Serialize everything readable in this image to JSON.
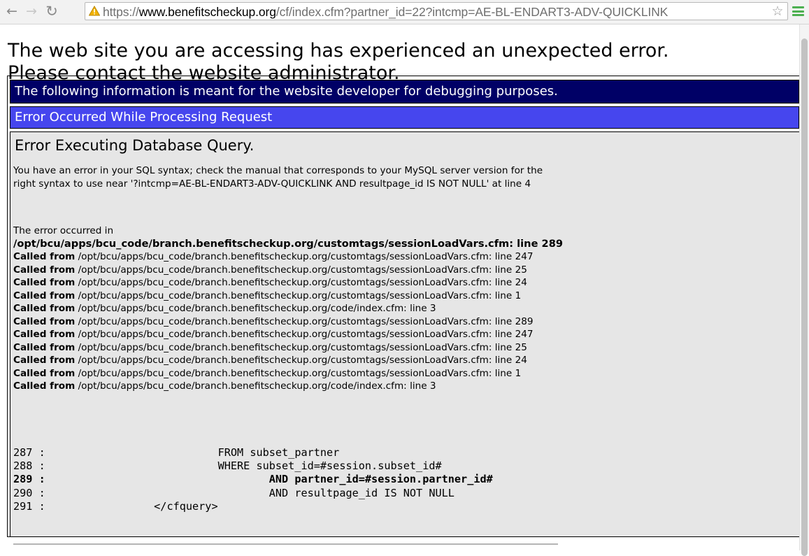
{
  "browser": {
    "back_glyph": "←",
    "forward_glyph": "→",
    "reload_glyph": "↻",
    "url_prefix": "https://",
    "url_host": "www.benefitscheckup.org",
    "url_rest": "/cf/index.cfm?partner_id=22?intcmp=AE-BL-ENDART3-ADV-QUICKLINK",
    "star_glyph": "☆",
    "accent_menu_color": "#4cb050",
    "warning_icon_color": "#f2b200"
  },
  "page": {
    "message_line1": "The web site you are accessing has experienced an unexpected error.",
    "message_line2": "Please contact the website administrator.",
    "debug_header": "The following information is meant for the website developer for debugging purposes.",
    "error_header": "Error Occurred While Processing Request",
    "error_title": "Error Executing Database Query.",
    "error_detail": "You have an error in your SQL syntax; check the manual that corresponds to your MySQL server version for the right syntax to use near '?intcmp=AE-BL-ENDART3-ADV-QUICKLINK AND resultpage_id IS NOT NULL' at line 4",
    "occurred_label": "The error occurred in",
    "occurred_location": "/opt/bcu/apps/bcu_code/branch.benefitscheckup.org/customtags/sessionLoadVars.cfm: line 289",
    "called_label": "Called from",
    "called_from": [
      " /opt/bcu/apps/bcu_code/branch.benefitscheckup.org/customtags/sessionLoadVars.cfm: line 247",
      " /opt/bcu/apps/bcu_code/branch.benefitscheckup.org/customtags/sessionLoadVars.cfm: line 25",
      " /opt/bcu/apps/bcu_code/branch.benefitscheckup.org/customtags/sessionLoadVars.cfm: line 24",
      " /opt/bcu/apps/bcu_code/branch.benefitscheckup.org/customtags/sessionLoadVars.cfm: line 1",
      " /opt/bcu/apps/bcu_code/branch.benefitscheckup.org/code/index.cfm: line 3",
      " /opt/bcu/apps/bcu_code/branch.benefitscheckup.org/customtags/sessionLoadVars.cfm: line 289",
      " /opt/bcu/apps/bcu_code/branch.benefitscheckup.org/customtags/sessionLoadVars.cfm: line 247",
      " /opt/bcu/apps/bcu_code/branch.benefitscheckup.org/customtags/sessionLoadVars.cfm: line 25",
      " /opt/bcu/apps/bcu_code/branch.benefitscheckup.org/customtags/sessionLoadVars.cfm: line 24",
      " /opt/bcu/apps/bcu_code/branch.benefitscheckup.org/customtags/sessionLoadVars.cfm: line 1",
      " /opt/bcu/apps/bcu_code/branch.benefitscheckup.org/code/index.cfm: line 3"
    ],
    "code_lines": [
      {
        "text": "287 :                           FROM subset_partner",
        "highlight": false
      },
      {
        "text": "288 :                           WHERE subset_id=#session.subset_id#",
        "highlight": false
      },
      {
        "text": "289 :                                   AND partner_id=#session.partner_id#",
        "highlight": true
      },
      {
        "text": "290 :                                   AND resultpage_id IS NOT NULL",
        "highlight": false
      },
      {
        "text": "291 :                 </cfquery>",
        "highlight": false
      }
    ]
  },
  "colors": {
    "debug_header_bg": "#000066",
    "error_header_bg": "#4646ee",
    "content_bg": "#e6e6e6"
  }
}
